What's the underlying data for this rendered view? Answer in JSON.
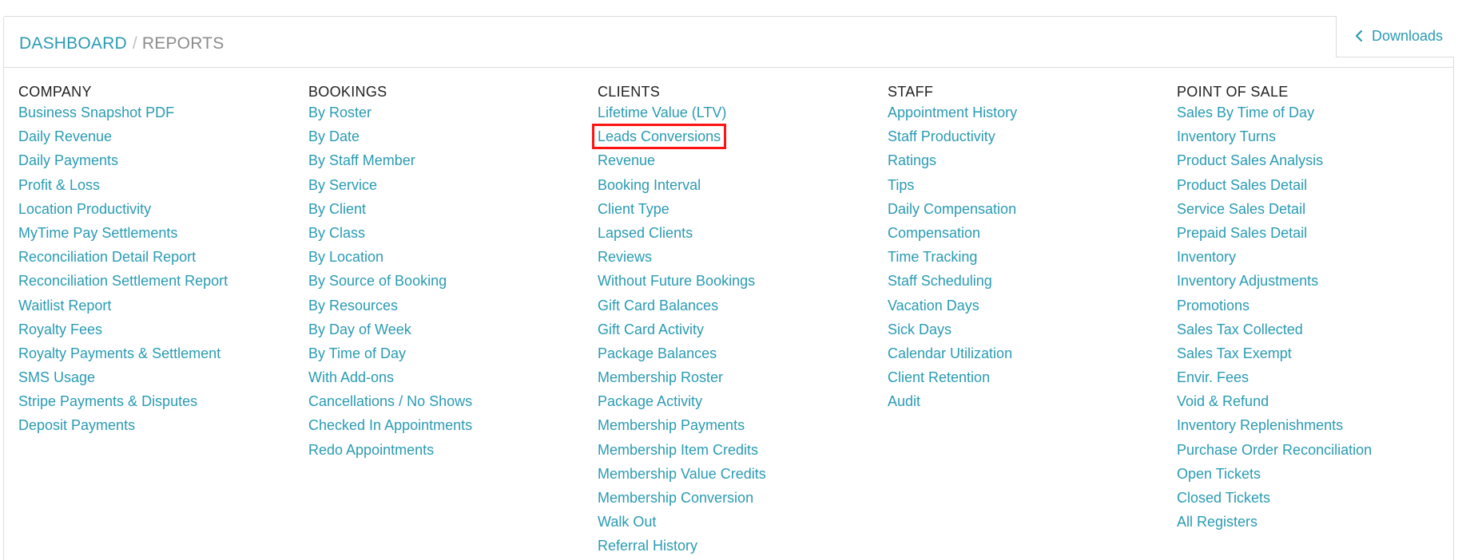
{
  "breadcrumb": {
    "dashboard": "DASHBOARD",
    "separator": "/",
    "current": "REPORTS"
  },
  "downloads": {
    "label": "Downloads",
    "icon": "chevron-left-icon"
  },
  "colors": {
    "link": "#2a9bb3",
    "heading": "#222222",
    "highlight": "#ff1414"
  },
  "columns": {
    "company": {
      "heading": "COMPANY",
      "items": [
        "Business Snapshot PDF",
        "Daily Revenue",
        "Daily Payments",
        "Profit & Loss",
        "Location Productivity",
        "MyTime Pay Settlements",
        "Reconciliation Detail Report",
        "Reconciliation Settlement Report",
        "Waitlist Report",
        "Royalty Fees",
        "Royalty Payments & Settlement",
        "SMS Usage",
        "Stripe Payments & Disputes",
        "Deposit Payments"
      ]
    },
    "bookings": {
      "heading": "BOOKINGS",
      "items": [
        "By Roster",
        "By Date",
        "By Staff Member",
        "By Service",
        "By Client",
        "By Class",
        "By Location",
        "By Source of Booking",
        "By Resources",
        "By Day of Week",
        "By Time of Day",
        "With Add-ons",
        "Cancellations / No Shows",
        "Checked In Appointments",
        "Redo Appointments"
      ]
    },
    "clients": {
      "heading": "CLIENTS",
      "highlighted_item": "Leads Conversions",
      "items": [
        "Lifetime Value (LTV)",
        "Leads Conversions",
        "Revenue",
        "Booking Interval",
        "Client Type",
        "Lapsed Clients",
        "Reviews",
        "Without Future Bookings",
        "Gift Card Balances",
        "Gift Card Activity",
        "Package Balances",
        "Membership Roster",
        "Package Activity",
        "Membership Payments",
        "Membership Item Credits",
        "Membership Value Credits",
        "Membership Conversion",
        "Walk Out",
        "Referral History"
      ]
    },
    "staff": {
      "heading": "STAFF",
      "items": [
        "Appointment History",
        "Staff Productivity",
        "Ratings",
        "Tips",
        "Daily Compensation",
        "Compensation",
        "Time Tracking",
        "Staff Scheduling",
        "Vacation Days",
        "Sick Days",
        "Calendar Utilization",
        "Client Retention",
        "Audit"
      ]
    },
    "point_of_sale": {
      "heading": "POINT OF SALE",
      "items": [
        "Sales By Time of Day",
        "Inventory Turns",
        "Product Sales Analysis",
        "Product Sales Detail",
        "Service Sales Detail",
        "Prepaid Sales Detail",
        "Inventory",
        "Inventory Adjustments",
        "Promotions",
        "Sales Tax Collected",
        "Sales Tax Exempt",
        "Envir. Fees",
        "Void & Refund",
        "Inventory Replenishments",
        "Purchase Order Reconciliation",
        "Open Tickets",
        "Closed Tickets",
        "All Registers"
      ]
    }
  }
}
